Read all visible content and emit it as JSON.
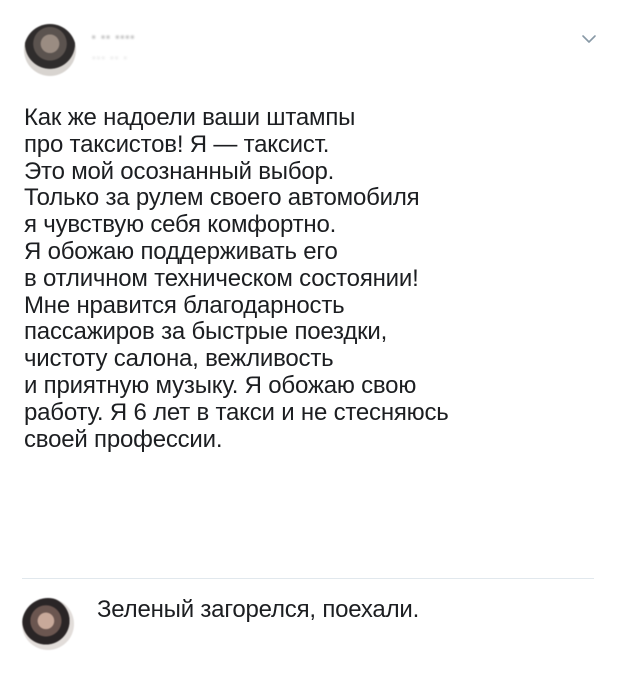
{
  "tweet": {
    "author_name": "· ·· ····",
    "author_handle": "··· ·· ·",
    "text": "Как же надоели ваши штампы\nпро таксистов! Я — таксист.\nЭто мой осознанный выбор.\nТолько за рулем своего автомобиля\nя чувствую себя комфортно.\nЯ обожаю поддерживать его\nв отличном техническом состоянии!\nМне нравится благодарность\nпассажиров за быстрые поездки,\nчистоту салона, вежливость\nи приятную музыку. Я обожаю свою\nработу. Я 6 лет в такси и не стесняюсь\nсвоей профессии.",
    "menu_icon": "chevron-down-icon"
  },
  "reply": {
    "text": "Зеленый загорелся, поехали."
  },
  "colors": {
    "text": "#1c1e21",
    "divider": "#e1e8ed",
    "chevron": "#8899a6"
  }
}
